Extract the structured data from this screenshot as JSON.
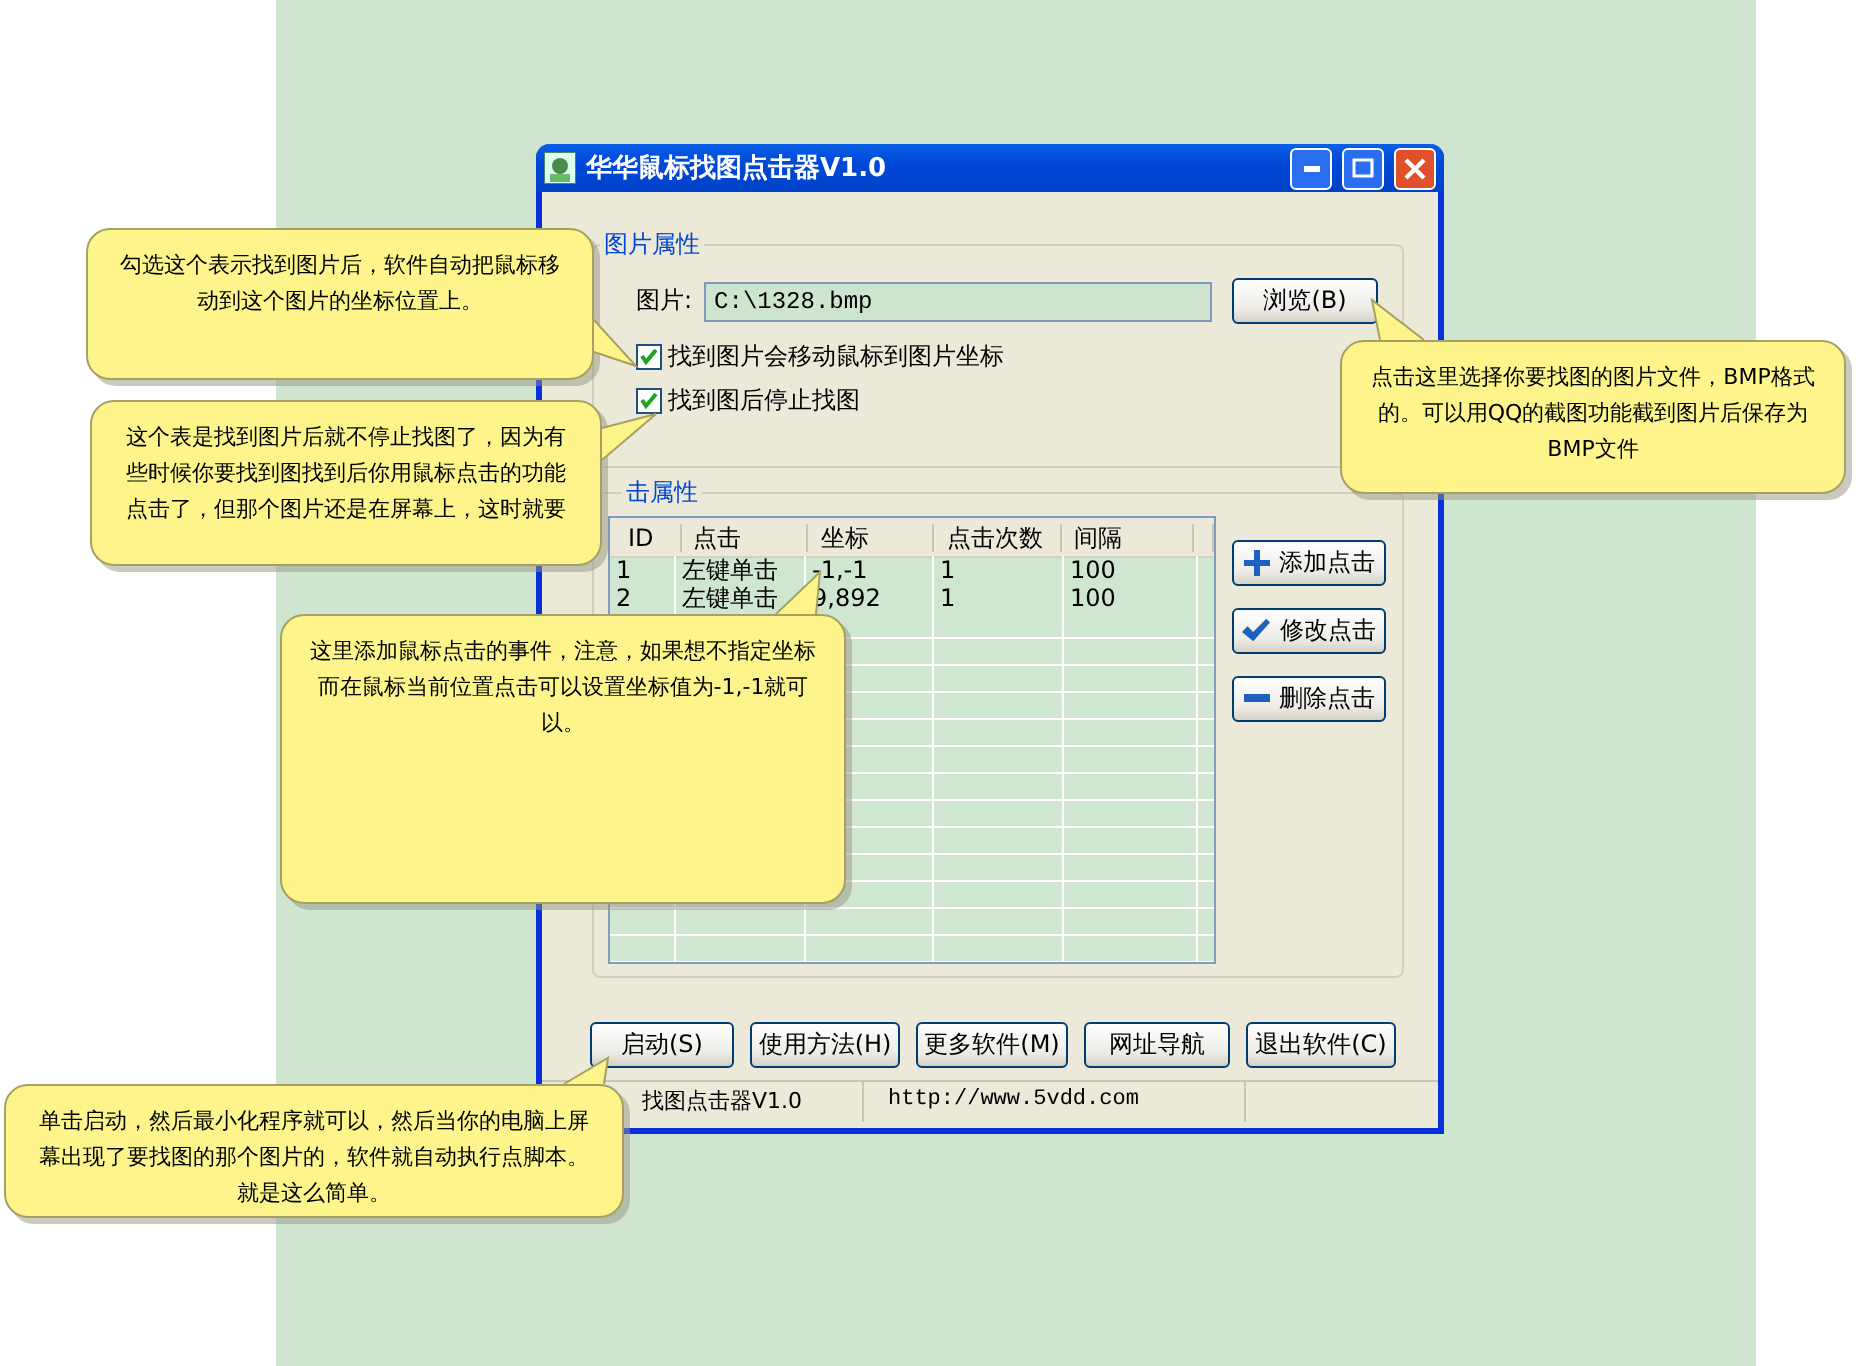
{
  "window": {
    "title": "华华鼠标找图点击器V1.0"
  },
  "image_group": {
    "title": "图片属性",
    "image_label": "图片:",
    "image_path": "C:\\1328.bmp",
    "browse_button": "浏览(B)",
    "checkboxes": [
      {
        "label": "找到图片会移动鼠标到图片坐标",
        "checked": true
      },
      {
        "label": "找到图后停止找图",
        "checked": true
      }
    ]
  },
  "click_group": {
    "title": "击属性",
    "table": {
      "columns": [
        "ID",
        "点击",
        "坐标",
        "点击次数",
        "间隔"
      ],
      "rows": [
        [
          "1",
          "左键单击",
          "-1,-1",
          "1",
          "100"
        ],
        [
          "2",
          "左键单击",
          "9,892",
          "1",
          "100"
        ]
      ]
    },
    "buttons": [
      {
        "label": "添加点击",
        "kind": "add"
      },
      {
        "label": "修改点击",
        "kind": "edit"
      },
      {
        "label": "删除点击",
        "kind": "delete"
      }
    ]
  },
  "footer_buttons": [
    "启动(S)",
    "使用方法(H)",
    "更多软件(M)",
    "网址导航",
    "退出软件(C)"
  ],
  "status_bar": [
    "找图点击器V1.0",
    "http://www.5vdd.com"
  ],
  "callouts": [
    {
      "text": "勾选这个表示找到图片后，软件自动把鼠标移动到这个图片的坐标位置上。"
    },
    {
      "text": "这个表是找到图片后就不停止找图了，因为有些时候你要找到图找到后你用鼠标点击的功能点击了，但那个图片还是在屏幕上，这时就要"
    },
    {
      "text": "这里添加鼠标点击的事件，注意，如果想不指定坐标而在鼠标当前位置点击可以设置坐标值为-1,-1就可以。"
    },
    {
      "text": "点击这里选择你要找图的图片文件，BMP格式的。可以用QQ的截图功能截到图片后保存为BMP文件"
    },
    {
      "text": "单击启动，然后最小化程序就可以，然后当你的电脑上屏幕出现了要找图的那个图片的，软件就自动执行点脚本。就是这么简单。"
    }
  ]
}
